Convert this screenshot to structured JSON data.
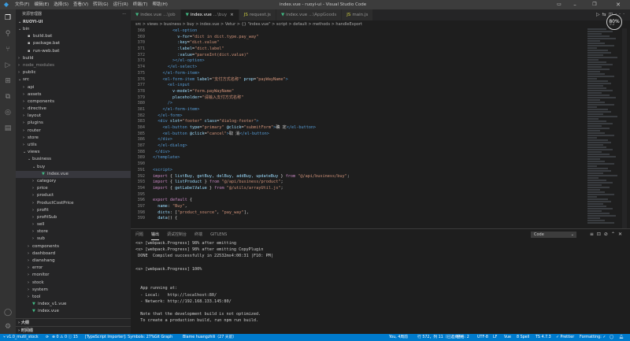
{
  "titlebar": {
    "menus": [
      "文件(F)",
      "编辑(E)",
      "选择(S)",
      "查看(V)",
      "转到(G)",
      "运行(R)",
      "终端(T)",
      "帮助(H)"
    ],
    "title": "index.vue - ruoyi-ui - Visual Studio Code"
  },
  "sidebar": {
    "header": "资源管理器",
    "project": "RUOYI-UI",
    "tree": [
      {
        "label": "bin",
        "depth": 0,
        "type": "folder-open"
      },
      {
        "label": "build.bat",
        "depth": 1,
        "type": "file-bat"
      },
      {
        "label": "package.bat",
        "depth": 1,
        "type": "file-bat"
      },
      {
        "label": "run-web.bat",
        "depth": 1,
        "type": "file-bat"
      },
      {
        "label": "build",
        "depth": 0,
        "type": "folder"
      },
      {
        "label": "node_modules",
        "depth": 0,
        "type": "folder-dim"
      },
      {
        "label": "public",
        "depth": 0,
        "type": "folder"
      },
      {
        "label": "src",
        "depth": 0,
        "type": "folder-open"
      },
      {
        "label": "api",
        "depth": 1,
        "type": "folder"
      },
      {
        "label": "assets",
        "depth": 1,
        "type": "folder"
      },
      {
        "label": "components",
        "depth": 1,
        "type": "folder"
      },
      {
        "label": "directive",
        "depth": 1,
        "type": "folder"
      },
      {
        "label": "layout",
        "depth": 1,
        "type": "folder"
      },
      {
        "label": "plugins",
        "depth": 1,
        "type": "folder"
      },
      {
        "label": "router",
        "depth": 1,
        "type": "folder"
      },
      {
        "label": "store",
        "depth": 1,
        "type": "folder"
      },
      {
        "label": "utils",
        "depth": 1,
        "type": "folder"
      },
      {
        "label": "views",
        "depth": 1,
        "type": "folder-open"
      },
      {
        "label": "business",
        "depth": 2,
        "type": "folder-open"
      },
      {
        "label": "buy",
        "depth": 3,
        "type": "folder-open"
      },
      {
        "label": "index.vue",
        "depth": 4,
        "type": "file-vue",
        "selected": true
      },
      {
        "label": "category",
        "depth": 3,
        "type": "folder"
      },
      {
        "label": "price",
        "depth": 3,
        "type": "folder"
      },
      {
        "label": "product",
        "depth": 3,
        "type": "folder"
      },
      {
        "label": "ProductCostPrice",
        "depth": 3,
        "type": "folder"
      },
      {
        "label": "profit",
        "depth": 3,
        "type": "folder"
      },
      {
        "label": "profitSub",
        "depth": 3,
        "type": "folder"
      },
      {
        "label": "sell",
        "depth": 3,
        "type": "folder"
      },
      {
        "label": "store",
        "depth": 3,
        "type": "folder"
      },
      {
        "label": "sub",
        "depth": 3,
        "type": "folder"
      },
      {
        "label": "components",
        "depth": 2,
        "type": "folder"
      },
      {
        "label": "dashboard",
        "depth": 2,
        "type": "folder"
      },
      {
        "label": "dianshang",
        "depth": 2,
        "type": "folder"
      },
      {
        "label": "error",
        "depth": 2,
        "type": "folder"
      },
      {
        "label": "monitor",
        "depth": 2,
        "type": "folder"
      },
      {
        "label": "stock",
        "depth": 2,
        "type": "folder"
      },
      {
        "label": "system",
        "depth": 2,
        "type": "folder"
      },
      {
        "label": "tool",
        "depth": 2,
        "type": "folder"
      },
      {
        "label": "index_v1.vue",
        "depth": 2,
        "type": "file-vue"
      },
      {
        "label": "index.vue",
        "depth": 2,
        "type": "file-vue"
      }
    ],
    "footer": [
      "大纲",
      "时间线"
    ]
  },
  "tabs": [
    {
      "label": "index.vue",
      "hint": "...\\job",
      "icon": "vue",
      "active": false
    },
    {
      "label": "index.vue",
      "hint": "...\\buy",
      "icon": "vue",
      "active": true
    },
    {
      "label": "request.js",
      "hint": "",
      "icon": "js",
      "active": false
    },
    {
      "label": "index.vue",
      "hint": "...\\AppGoods",
      "icon": "vue",
      "active": false
    },
    {
      "label": "main.js",
      "hint": "",
      "icon": "js",
      "active": false
    }
  ],
  "breadcrumb": "src > views > business > buy > index.vue > Vetur > {} \"index.vue\" > script > default > methods > handleExport",
  "code": [
    {
      "n": "368",
      "html": "        <span class=\"tg\">&lt;el-option</span>"
    },
    {
      "n": "369",
      "html": "          <span class=\"at\">v-for</span><span class=\"pl\">=</span><span class=\"st\">\"dict in dict.type.pay_way\"</span>"
    },
    {
      "n": "370",
      "html": "          <span class=\"at\">:key</span><span class=\"pl\">=</span><span class=\"st\">\"dict.value\"</span>"
    },
    {
      "n": "371",
      "html": "          <span class=\"at\">:label</span><span class=\"pl\">=</span><span class=\"st\">\"dict.label\"</span>"
    },
    {
      "n": "372",
      "html": "          <span class=\"at\">:value</span><span class=\"pl\">=</span><span class=\"st\">\"parseInt(dict.value)\"</span>"
    },
    {
      "n": "373",
      "html": "        <span class=\"tg\">&gt;&lt;/el-option&gt;</span>"
    },
    {
      "n": "374",
      "html": "      <span class=\"tg\">&lt;/el-select&gt;</span>"
    },
    {
      "n": "375",
      "html": "    <span class=\"tg\">&lt;/el-form-item&gt;</span>"
    },
    {
      "n": "376",
      "html": "    <span class=\"tg\">&lt;el-form-item</span> <span class=\"at\">label</span><span class=\"pl\">=</span><span class=\"st\">\"支付方式名称\"</span> <span class=\"at\">prop</span><span class=\"pl\">=</span><span class=\"st\">\"payWayName\"</span><span class=\"tg\">&gt;</span>"
    },
    {
      "n": "377",
      "html": "      <span class=\"tg\">&lt;el-input</span>"
    },
    {
      "n": "378",
      "html": "        <span class=\"at\">v-model</span><span class=\"pl\">=</span><span class=\"st\">\"form.payWayName\"</span>"
    },
    {
      "n": "379",
      "html": "        <span class=\"at\">placeholder</span><span class=\"pl\">=</span><span class=\"st\">\"请输入支付方式名称\"</span>"
    },
    {
      "n": "380",
      "html": "      <span class=\"tg\">/&gt;</span>"
    },
    {
      "n": "381",
      "html": "    <span class=\"tg\">&lt;/el-form-item&gt;</span>"
    },
    {
      "n": "382",
      "html": "  <span class=\"tg\">&lt;/el-form&gt;</span>"
    },
    {
      "n": "383",
      "html": "  <span class=\"tg\">&lt;div</span> <span class=\"at\">slot</span><span class=\"pl\">=</span><span class=\"st\">\"footer\"</span> <span class=\"at\">class</span><span class=\"pl\">=</span><span class=\"st\">\"dialog-footer\"</span><span class=\"tg\">&gt;</span>"
    },
    {
      "n": "384",
      "html": "    <span class=\"tg\">&lt;el-button</span> <span class=\"at\">type</span><span class=\"pl\">=</span><span class=\"st\">\"primary\"</span> <span class=\"at\">@click</span><span class=\"pl\">=</span><span class=\"st\">\"submitForm\"</span><span class=\"tg\">&gt;</span><span class=\"pl\">确 定</span><span class=\"tg\">&lt;/el-button&gt;</span>"
    },
    {
      "n": "385",
      "html": "    <span class=\"tg\">&lt;el-button</span> <span class=\"at\">@click</span><span class=\"pl\">=</span><span class=\"st\">\"cancel\"</span><span class=\"tg\">&gt;</span><span class=\"pl\">取 消</span><span class=\"tg\">&lt;/el-button&gt;</span>"
    },
    {
      "n": "386",
      "html": "  <span class=\"tg\">&lt;/div&gt;</span>"
    },
    {
      "n": "387",
      "html": "  <span class=\"tg\">&lt;/el-dialog&gt;</span>"
    },
    {
      "n": "388",
      "html": " <span class=\"tg\">&lt;/div&gt;</span>"
    },
    {
      "n": "389",
      "html": "<span class=\"tg\">&lt;/template&gt;</span>"
    },
    {
      "n": "390",
      "html": ""
    },
    {
      "n": "391",
      "html": "<span class=\"tg\">&lt;script&gt;</span>"
    },
    {
      "n": "392",
      "html": "<span class=\"kw\">import</span> <span class=\"pl\">{ </span><span class=\"at\">listBuy, getBuy, delBuy, addBuy, updateBuy</span><span class=\"pl\"> } </span><span class=\"kw\">from</span> <span class=\"st\">\"@/api/business/buy\"</span><span class=\"pl\">;</span>"
    },
    {
      "n": "393",
      "html": "<span class=\"kw\">import</span> <span class=\"pl\">{ </span><span class=\"at\">listProduct</span><span class=\"pl\"> } </span><span class=\"kw\">from</span> <span class=\"st\">\"@/api/business/product\"</span><span class=\"pl\">;</span>"
    },
    {
      "n": "394",
      "html": "<span class=\"kw\">import</span> <span class=\"pl\">{ </span><span class=\"at\">getLabelValue</span><span class=\"pl\"> } </span><span class=\"kw\">from</span> <span class=\"st\">\"@/utils/arrayUtil.js\"</span><span class=\"pl\">;</span>"
    },
    {
      "n": "395",
      "html": ""
    },
    {
      "n": "396",
      "html": "<span class=\"kw\">export default</span> <span class=\"pl\">{</span>"
    },
    {
      "n": "397",
      "html": "  <span class=\"at\">name</span><span class=\"pl\">: </span><span class=\"st\">\"Buy\"</span><span class=\"pl\">,</span>"
    },
    {
      "n": "398",
      "html": "  <span class=\"at\">dicts</span><span class=\"pl\">: [</span><span class=\"st\">\"product_source\"</span><span class=\"pl\">, </span><span class=\"st\">\"pay_way\"</span><span class=\"pl\">],</span>"
    },
    {
      "n": "399",
      "html": "  <span class=\"at\">data</span><span class=\"pl\">() {</span>"
    }
  ],
  "zoom": {
    "value": "80",
    "unit": "%",
    "sub": "0.2"
  },
  "panel": {
    "tabs": [
      "问题",
      "输出",
      "调试控制台",
      "终端",
      "GITLENS"
    ],
    "active_tab": "输出",
    "select_value": "Code",
    "lines": [
      "<s> [webpack.Progress] 98% after emitting",
      "<s> [webpack.Progress] 98% after emitting CopyPlugin",
      " DONE  Compiled successfully in 22532ms4:00:31 |F10: PM|",
      "",
      "<s> [webpack.Progress] 100%",
      "",
      "",
      "  App running at:",
      "  - Local:   http://localhost:80/",
      "  - Network: http://192.168.133.145:80/",
      "",
      "  Note that the development build is not optimized.",
      "  To create a production build, run npm run build.",
      ""
    ]
  },
  "statusbar": {
    "branch": "v1.0_mutil_stock",
    "sync": "⟳",
    "problems": "⊗ 0 ⚠ 0 ⓘ 15",
    "ts_importer": "[TypeScript Importer]: Symbols: 27%",
    "git_graph": "Git Graph",
    "blame": "Blame huangzhili（27 天前）",
    "author": "You, 4周前",
    "position": "行 572，列 11（已选择4）",
    "spaces": "空格: 2",
    "encoding": "UTF-8",
    "eol": "LF",
    "language": "Vue",
    "spell": "8 Spell",
    "ts_version": "TS 4.7.3",
    "prettier": "✓ Prettier",
    "formatting": "Formatting: ✓"
  }
}
